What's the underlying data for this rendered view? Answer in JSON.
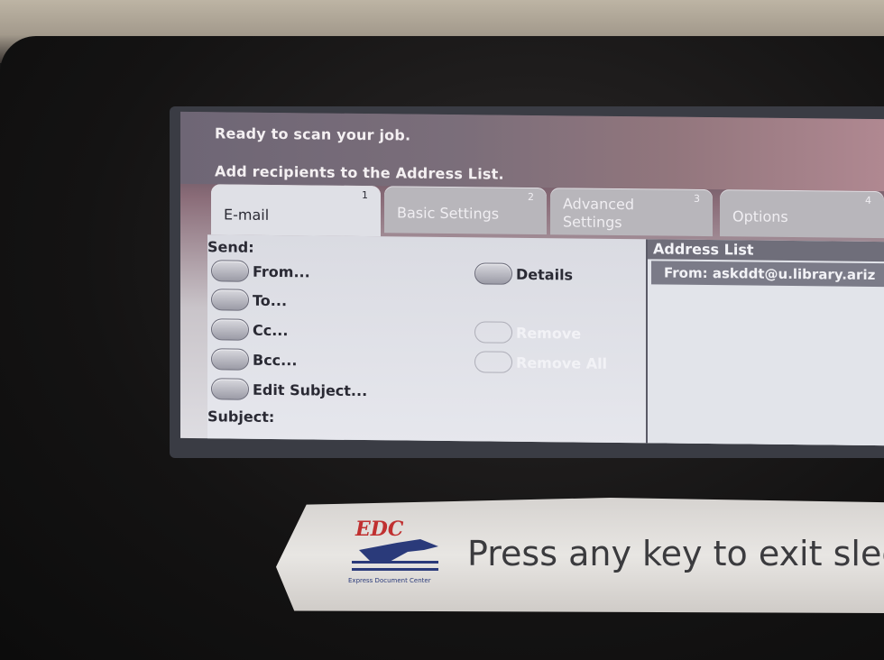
{
  "status": {
    "line1": "Ready to scan your job.",
    "line2": "Add recipients to the Address List."
  },
  "tabs": [
    {
      "label": "E-mail",
      "number": "1"
    },
    {
      "label": "Basic Settings",
      "number": "2"
    },
    {
      "label": "Advanced Settings",
      "number": "3"
    },
    {
      "label": "Options",
      "number": "4"
    }
  ],
  "panel": {
    "send_label": "Send:",
    "subject_label": "Subject:",
    "buttons": {
      "from": "From...",
      "to": "To...",
      "cc": "Cc...",
      "bcc": "Bcc...",
      "edit_subject": "Edit Subject...",
      "details": "Details",
      "remove": "Remove",
      "remove_all": "Remove All"
    }
  },
  "address_list": {
    "header": "Address List",
    "items": [
      "From: askddt@u.library.ariz"
    ]
  },
  "sticker": {
    "logo": "EDC",
    "logo_caption": "Express Document Center",
    "message": "Press any key to exit slee"
  },
  "colors": {
    "screen_header": "#7b6e7a",
    "panel_bg": "#e2e3e9",
    "logo_red": "#c03030"
  }
}
